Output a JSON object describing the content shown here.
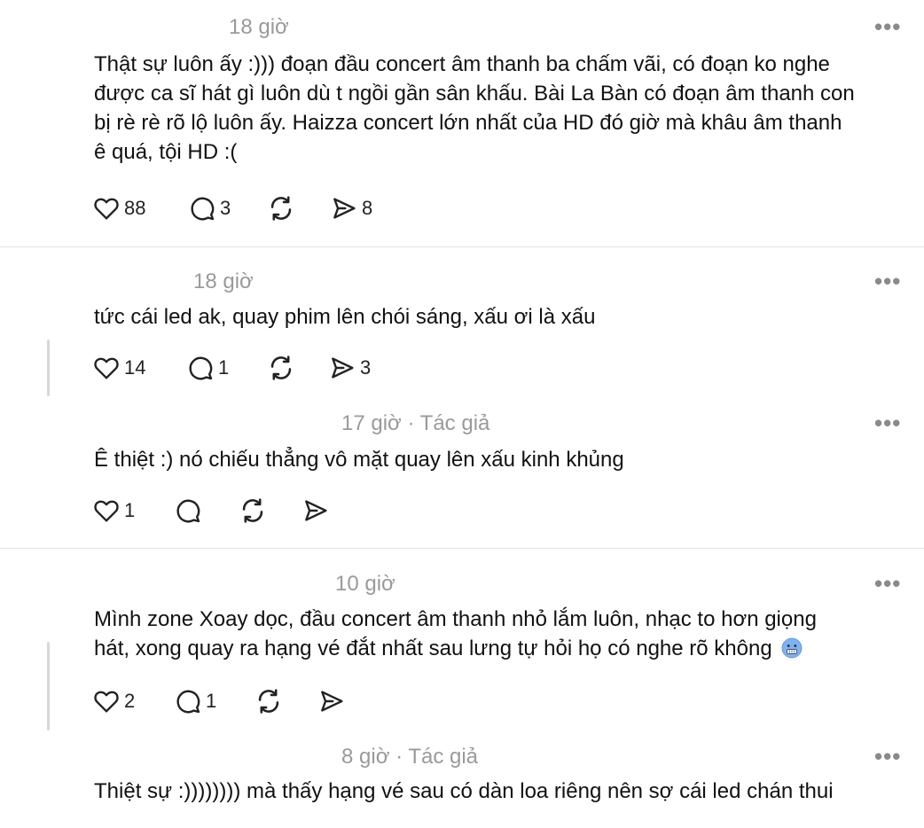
{
  "comments": [
    {
      "time": "18 giờ",
      "lines": [
        "Thật sự luôn ấy :))) đoạn đầu concert âm thanh ba chấm vãi, có đoạn ko nghe",
        "được ca sĩ hát gì luôn dù t ngồi gần sân khấu. Bài La Bàn có đoạn âm thanh con",
        "bị rè rè rõ lộ luôn ấy. Haizza concert lớn nhất của HD đó giờ mà khâu âm thanh",
        "ê quá, tội HD :("
      ],
      "likes": "88",
      "replies": "3",
      "shares": "8"
    },
    {
      "time": "18 giờ",
      "lines": [
        "tức cái led ak, quay phim lên chói sáng, xấu ơi là xấu"
      ],
      "likes": "14",
      "replies": "1",
      "shares": "3"
    },
    {
      "time": "17 giờ · Tác giả",
      "lines": [
        "Ê thiệt :) nó chiếu thẳng vô mặt quay lên xấu kinh khủng"
      ],
      "likes": "1",
      "replies": "",
      "shares": ""
    },
    {
      "time": "10 giờ",
      "lines": [
        "Mình zone Xoay dọc, đầu concert âm thanh nhỏ lắm luôn, nhạc to hơn giọng",
        "hát, xong quay ra hạng vé đắt nhất sau lưng tự hỏi họ có nghe rõ không"
      ],
      "emoji": "cold-face-emoji",
      "likes": "2",
      "replies": "1",
      "shares": ""
    },
    {
      "time": "8 giờ · Tác giả",
      "lines": [
        "Thiệt sự :)))))))) mà thấy hạng vé sau có dàn loa riêng nên sợ cái led chán thui"
      ]
    }
  ],
  "icons": [
    "heart-icon",
    "comment-icon",
    "repost-icon",
    "share-icon",
    "more-icon"
  ],
  "colors": {
    "text": "#111111",
    "meta": "#9a9a9a",
    "divider": "#e3e3e3",
    "icon": "#222222"
  },
  "more_label": "•••"
}
